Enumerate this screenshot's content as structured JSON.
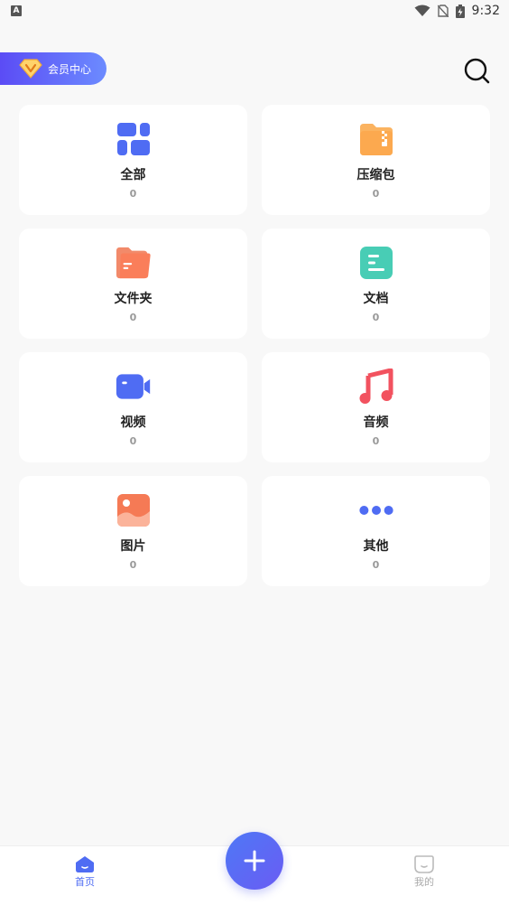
{
  "status_bar": {
    "left_icon": "A",
    "time": "9:32"
  },
  "header": {
    "vip_label": "会员中心"
  },
  "categories": [
    {
      "label": "全部",
      "count": "0",
      "icon": "grid-icon"
    },
    {
      "label": "压缩包",
      "count": "0",
      "icon": "zip-folder-icon"
    },
    {
      "label": "文件夹",
      "count": "0",
      "icon": "folder-icon"
    },
    {
      "label": "文档",
      "count": "0",
      "icon": "document-icon"
    },
    {
      "label": "视频",
      "count": "0",
      "icon": "video-icon"
    },
    {
      "label": "音频",
      "count": "0",
      "icon": "music-icon"
    },
    {
      "label": "图片",
      "count": "0",
      "icon": "image-icon"
    },
    {
      "label": "其他",
      "count": "0",
      "icon": "more-dots-icon"
    }
  ],
  "bottom_nav": {
    "home_label": "首页",
    "mine_label": "我的"
  },
  "colors": {
    "accent": "#4f6cf3",
    "background": "#f8f8f8"
  }
}
